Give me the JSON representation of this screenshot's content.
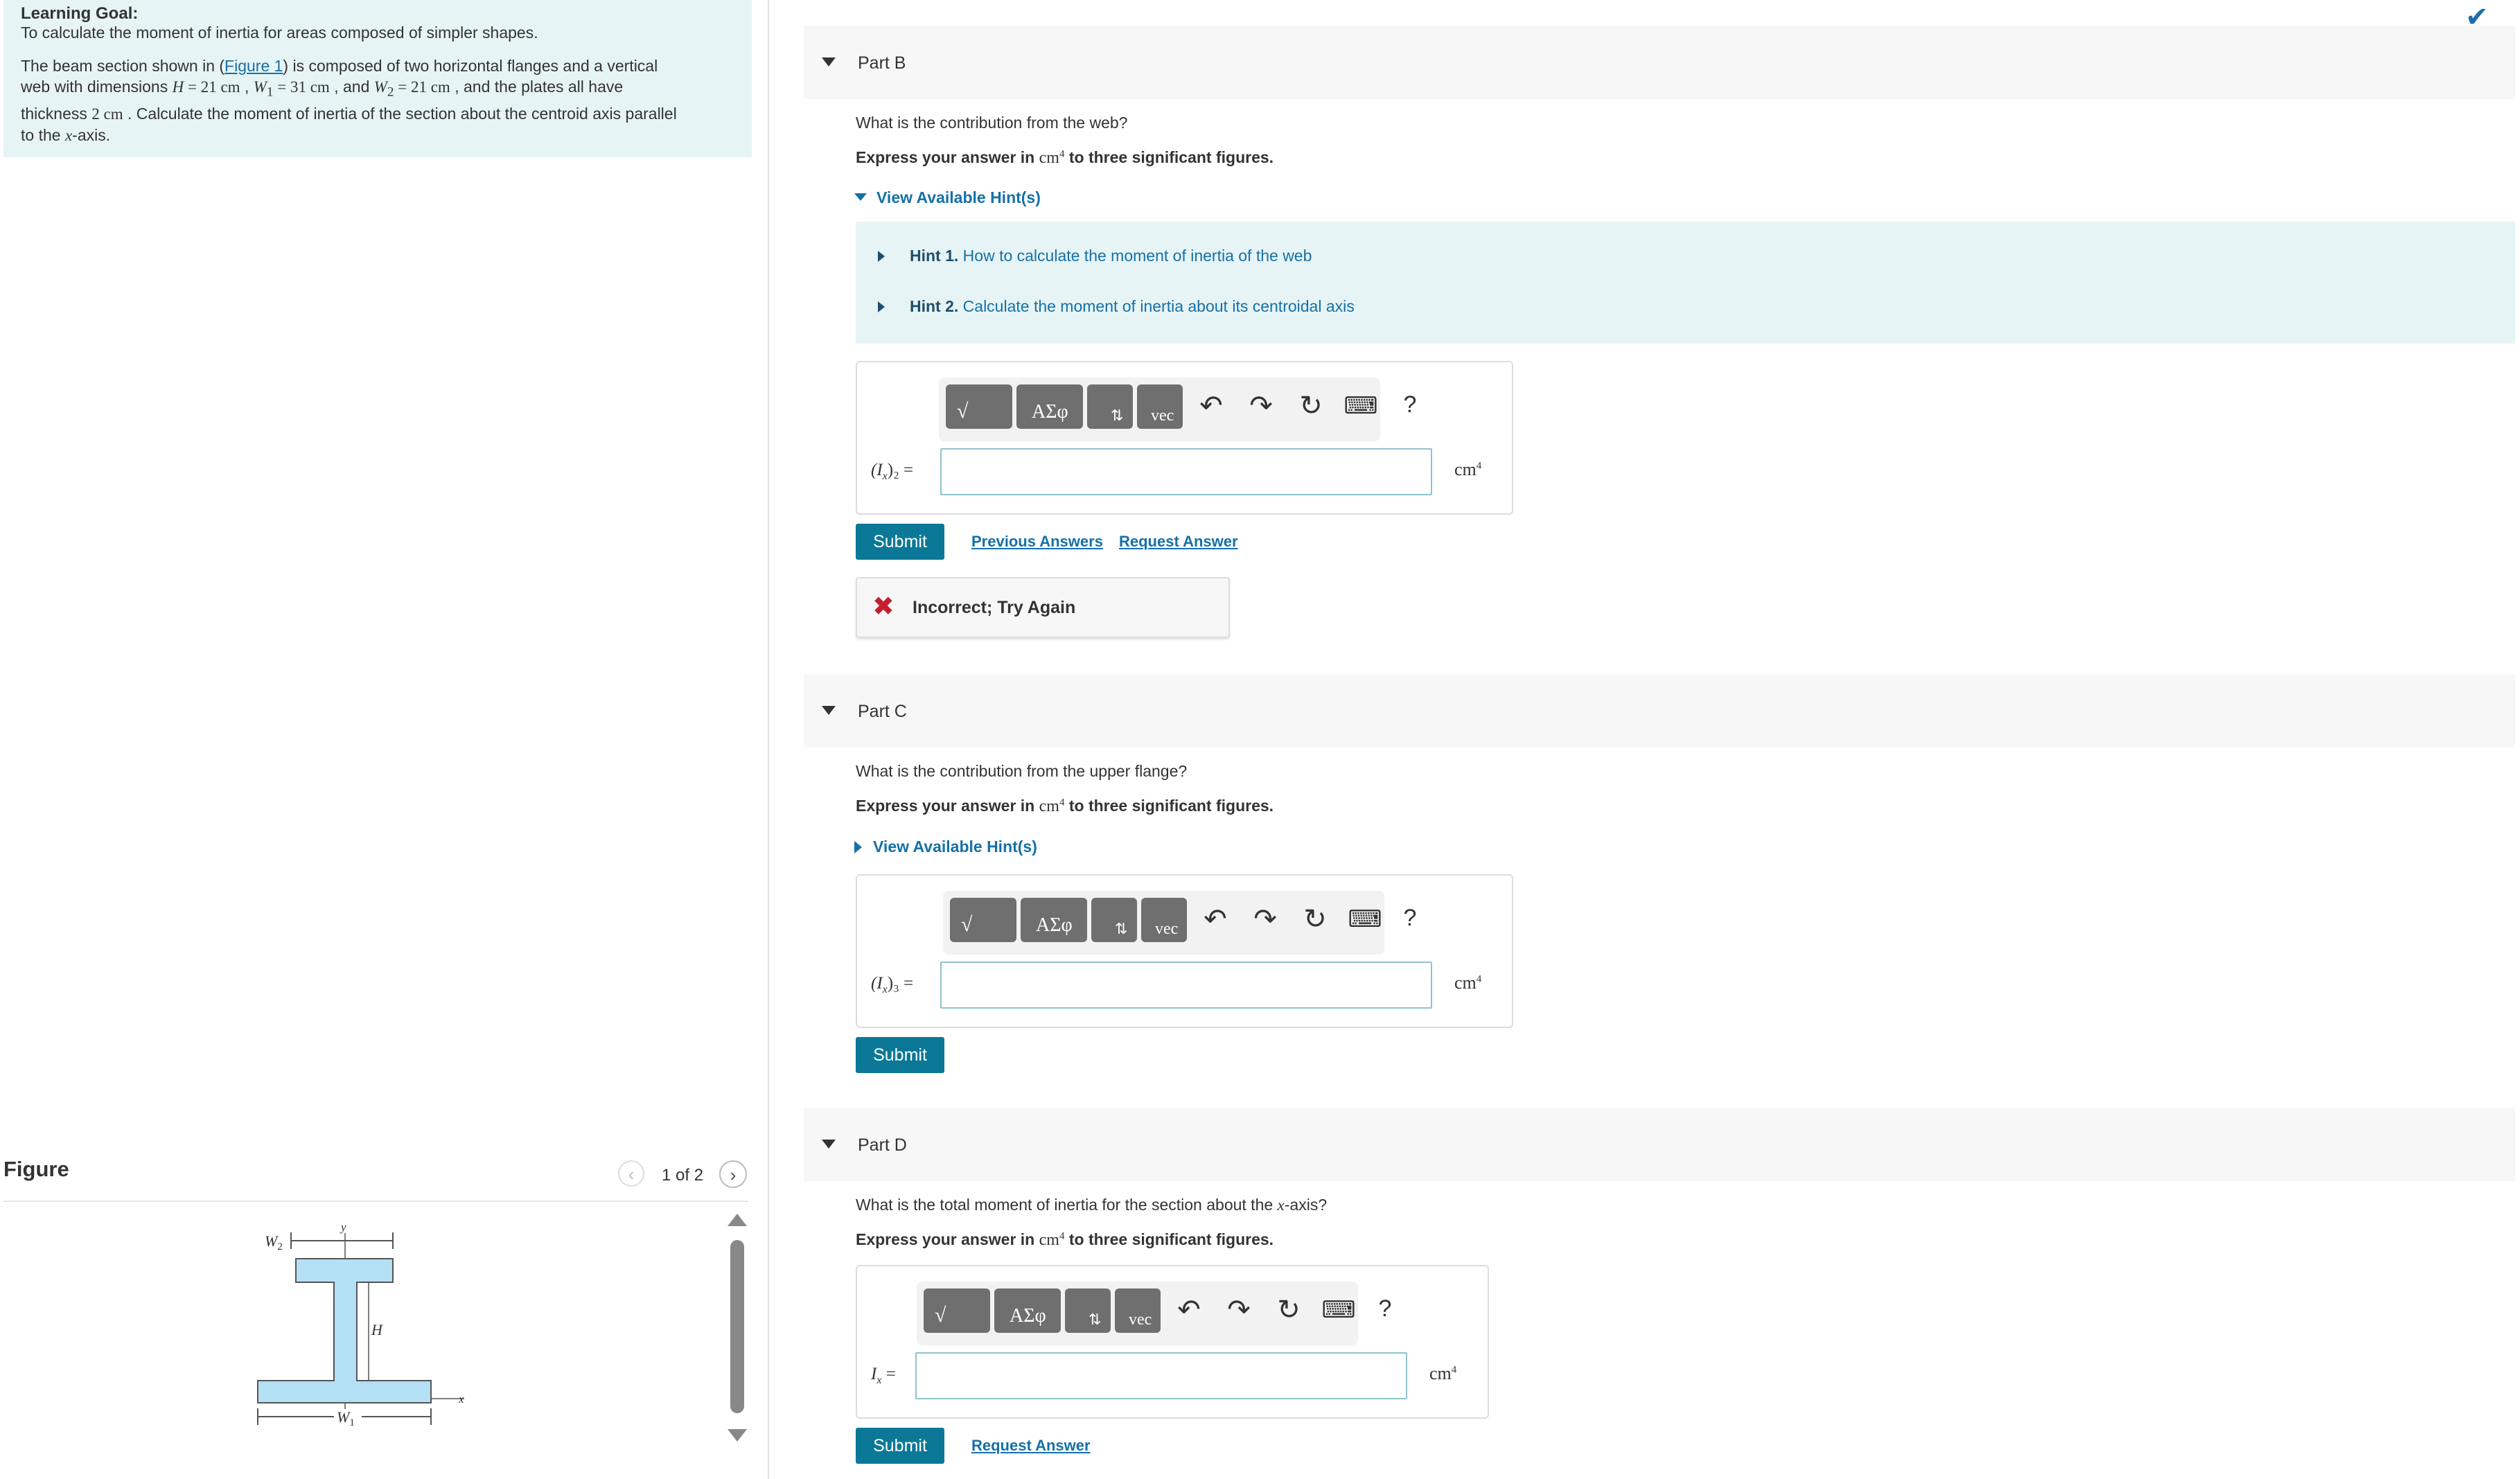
{
  "learning_goal": {
    "title": "Learning Goal:",
    "line1": "To calculate the moment of inertia for areas composed of simpler shapes.",
    "intro_a": "The beam section shown in (",
    "figure_link": "Figure 1",
    "intro_b": ") is composed of two horizontal flanges and a vertical",
    "intro_c": "web with dimensions ",
    "H_sym": "H",
    "H_val": " = 21 cm",
    "W1_sym": "W",
    "W1_sub": "1",
    "W1_val": " = 31 cm",
    "and_w2": " , and ",
    "W2_sym": "W",
    "W2_sub": "2",
    "W2_val": " = 21 cm",
    "intro_d": " , and the plates all have",
    "thick_a": "thickness ",
    "thick_val": "2 cm",
    "thick_b": " . Calculate the moment of inertia of the section about the centroid axis parallel",
    "last_a": "to the ",
    "last_x": "x",
    "last_b": "-axis."
  },
  "figure": {
    "title": "Figure",
    "count": "1 of 2",
    "labels": {
      "w2": "W",
      "w2_sub": "2",
      "w1": "W",
      "w1_sub": "1",
      "h": "H",
      "y": "y",
      "x": "x"
    },
    "fill_color": "#b3e0f5",
    "stroke_color": "#555555"
  },
  "parts": {
    "b": {
      "title": "Part B",
      "question": "What is the contribution from the web?",
      "instr_a": "Express your answer in ",
      "unit": "cm",
      "unit_exp": "4",
      "instr_b": " to three significant figures.",
      "hints_toggle": "View Available Hint(s)",
      "hint1_num": "Hint 1.",
      "hint1_text": " How to calculate the moment of inertia of the web",
      "hint2_num": "Hint 2.",
      "hint2_text": " Calculate the moment of inertia about its centroidal axis",
      "answer_label_sym": "(I",
      "answer_label_sub": "x",
      "answer_label_rest": ")₂ =",
      "answer_value": "",
      "submit": "Submit",
      "previous_answers": "Previous Answers",
      "request_answer": "Request Answer",
      "feedback": "Incorrect; Try Again"
    },
    "c": {
      "title": "Part C",
      "question": "What is the contribution from the upper flange?",
      "instr_a": "Express your answer in ",
      "unit": "cm",
      "unit_exp": "4",
      "instr_b": " to three significant figures.",
      "hints_toggle": "View Available Hint(s)",
      "answer_label_sym": "(I",
      "answer_label_sub": "x",
      "answer_label_rest": ")₃ =",
      "answer_value": "",
      "submit": "Submit"
    },
    "d": {
      "title": "Part D",
      "question_a": "What is the total moment of inertia for the section about the ",
      "question_x": "x",
      "question_b": "-axis?",
      "instr_a": "Express your answer in ",
      "unit": "cm",
      "unit_exp": "4",
      "instr_b": " to three significant figures.",
      "answer_label_sym": "I",
      "answer_label_sub": "x",
      "answer_label_rest": " =",
      "answer_value": "",
      "submit": "Submit",
      "request_answer": "Request Answer"
    }
  },
  "toolbar": {
    "templates_btn": "√",
    "greek_btn": "ΑΣφ",
    "arrows_btn": "⇅",
    "vec_btn": "vec",
    "undo_icon": "↶",
    "redo_icon": "↷",
    "reset_icon": "↻",
    "keyboard_icon": "⌨",
    "help_icon": "?"
  },
  "status": {
    "complete_icon": "✔"
  },
  "colors": {
    "accent": "#0b7897",
    "link": "#1570a8",
    "hint_bg": "#e6f4f5",
    "error": "#c41e2f"
  }
}
